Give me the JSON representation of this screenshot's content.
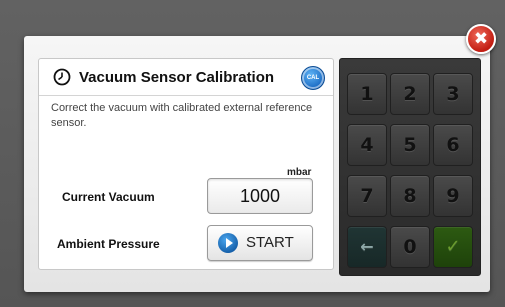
{
  "dialog": {
    "title": "Vacuum Sensor Calibration",
    "badge": "CAL",
    "description": "Correct the vacuum with calibrated external reference sensor.",
    "unit": "mbar",
    "current_vacuum_label": "Current Vacuum",
    "current_vacuum_value": "1000",
    "ambient_pressure_label": "Ambient Pressure",
    "start_label": "START",
    "close_glyph": "✖"
  },
  "keypad": {
    "keys": [
      "1",
      "2",
      "3",
      "4",
      "5",
      "6",
      "7",
      "8",
      "9",
      "←",
      "0",
      "✓"
    ]
  },
  "icons": {
    "title_icon": "clock-icon",
    "badge_icon": "cal-icon",
    "start_icon": "play-icon",
    "close_icon": "close-icon"
  },
  "colors": {
    "accent_blue": "#1565c0",
    "close_red": "#c21d12",
    "confirm_green": "#2d5a12",
    "keypad_bg": "#2f2f2f"
  }
}
